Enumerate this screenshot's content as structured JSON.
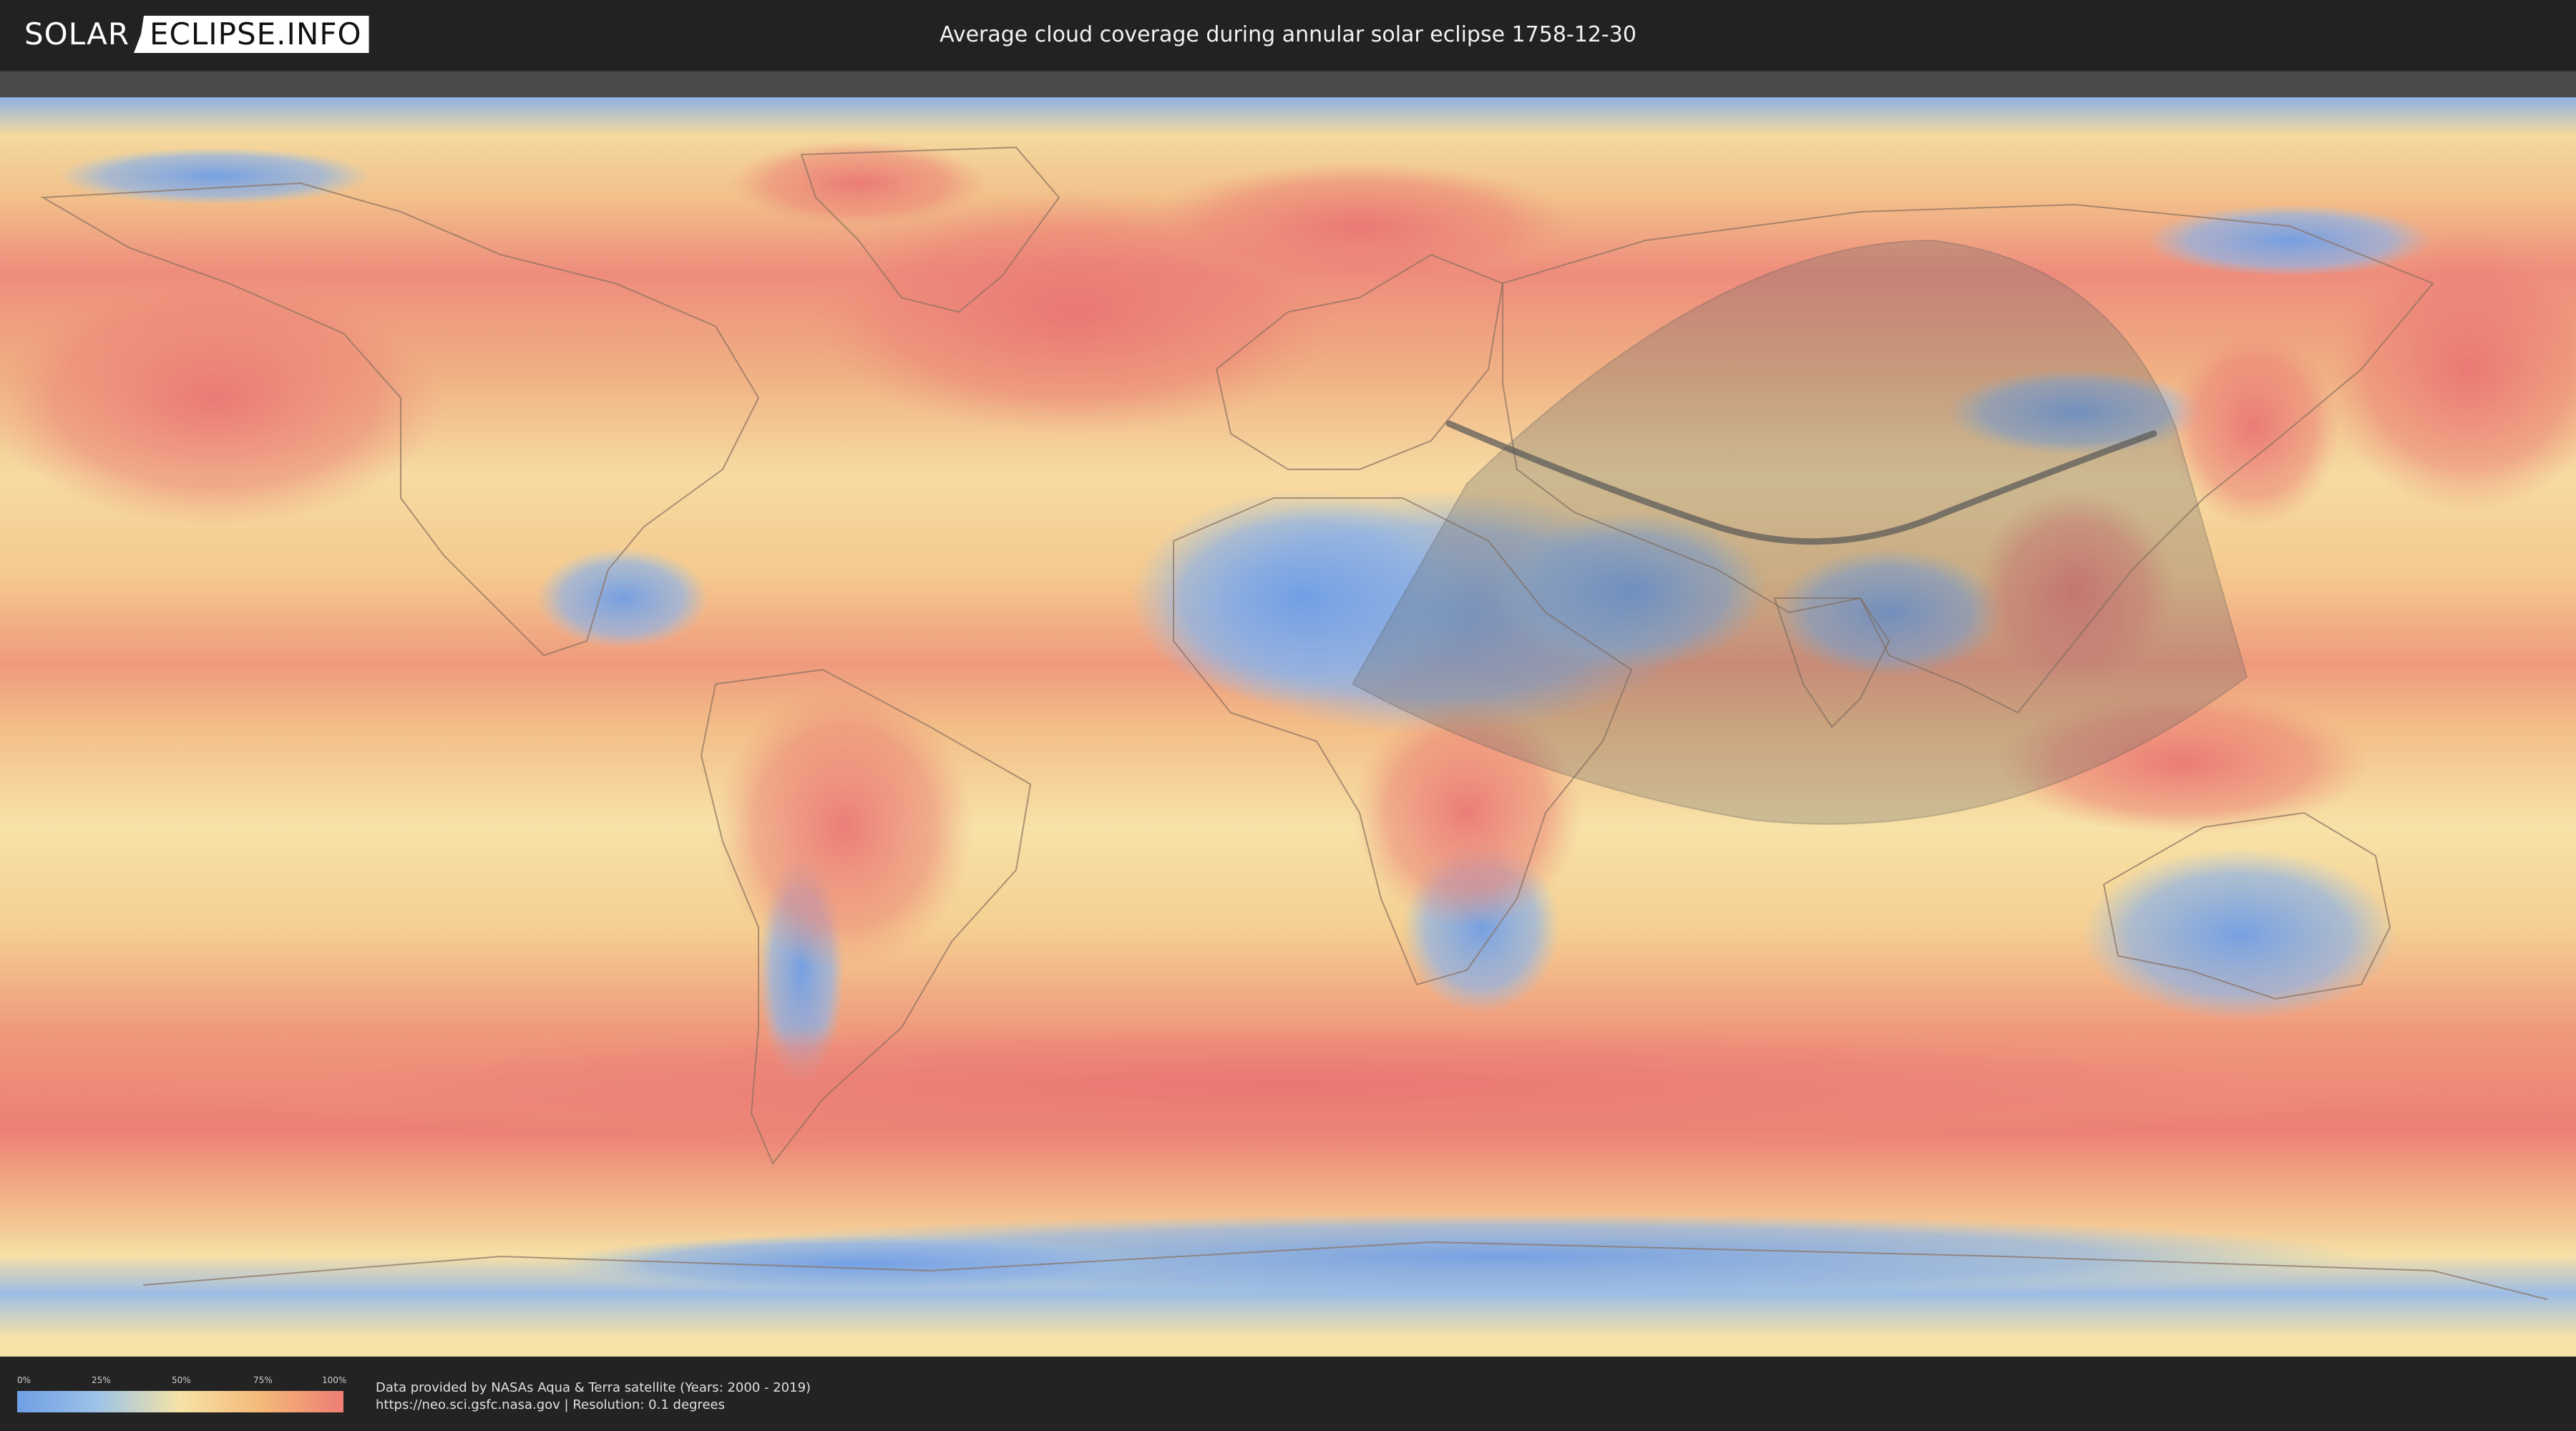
{
  "header": {
    "logo_part1": "SOLAR",
    "logo_part2": "ECLIPSE.INFO",
    "title": "Average cloud coverage during annular solar eclipse 1758-12-30"
  },
  "legend": {
    "ticks": [
      "0%",
      "25%",
      "50%",
      "75%",
      "100%"
    ],
    "colors": [
      "#6f9ee6",
      "#9ec4e6",
      "#f6e3a6",
      "#f4b878",
      "#ee7d74"
    ]
  },
  "credits": {
    "line1": "Data provided by NASAs Aqua & Terra satellite (Years: 2000 - 2019)",
    "line2": "https://neo.sci.gsfc.nasa.gov | Resolution: 0.1 degrees"
  },
  "map": {
    "projection": "equirectangular",
    "layer": "average cloud coverage",
    "overlay_color": "#6b6b6b",
    "path_color": "#555555"
  }
}
